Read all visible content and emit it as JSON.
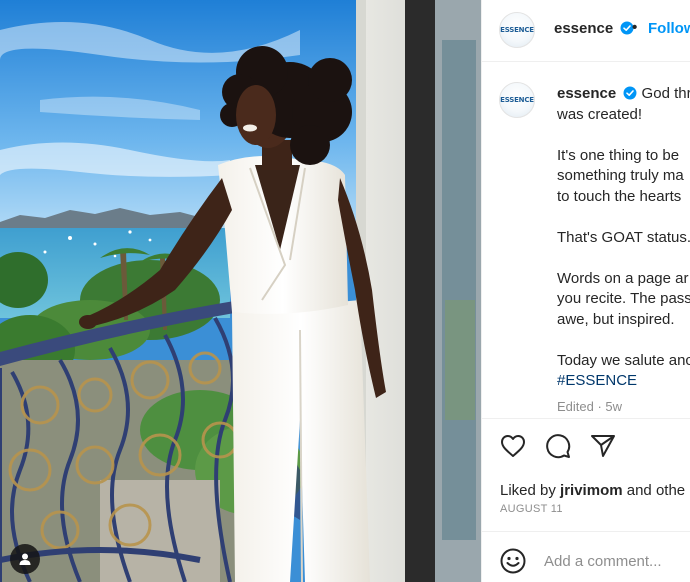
{
  "post": {
    "username": "essence",
    "avatar_text": "ESSENCE",
    "follow_label": "Follow",
    "separator": "•",
    "verified_icon": "verified-badge-icon",
    "caption": {
      "username": "essence",
      "line1_rest": " God thre",
      "line2": "was created!",
      "line3": "It's one thing to be",
      "line4": "something truly ma",
      "line5": "to touch the hearts",
      "line6": "That's GOAT status.",
      "line7": "Words on a page ar",
      "line8": "you recite. The pass",
      "line9": "awe, but inspired.",
      "line10": "Today we salute anc",
      "hashtag": "#ESSENCE"
    },
    "edited_label": "Edited · 5w",
    "likes_prefix": "Liked by ",
    "likes_user": "jrivimom",
    "likes_suffix": " and othe",
    "date": "AUGUST 11",
    "comment_placeholder": "Add a comment...",
    "colors": {
      "accent": "#0095f6",
      "verified": "#0095f6",
      "muted": "#8e8e8e"
    },
    "icons": [
      "heart-icon",
      "comment-icon",
      "share-icon",
      "emoji-icon",
      "user-tag-icon"
    ]
  }
}
